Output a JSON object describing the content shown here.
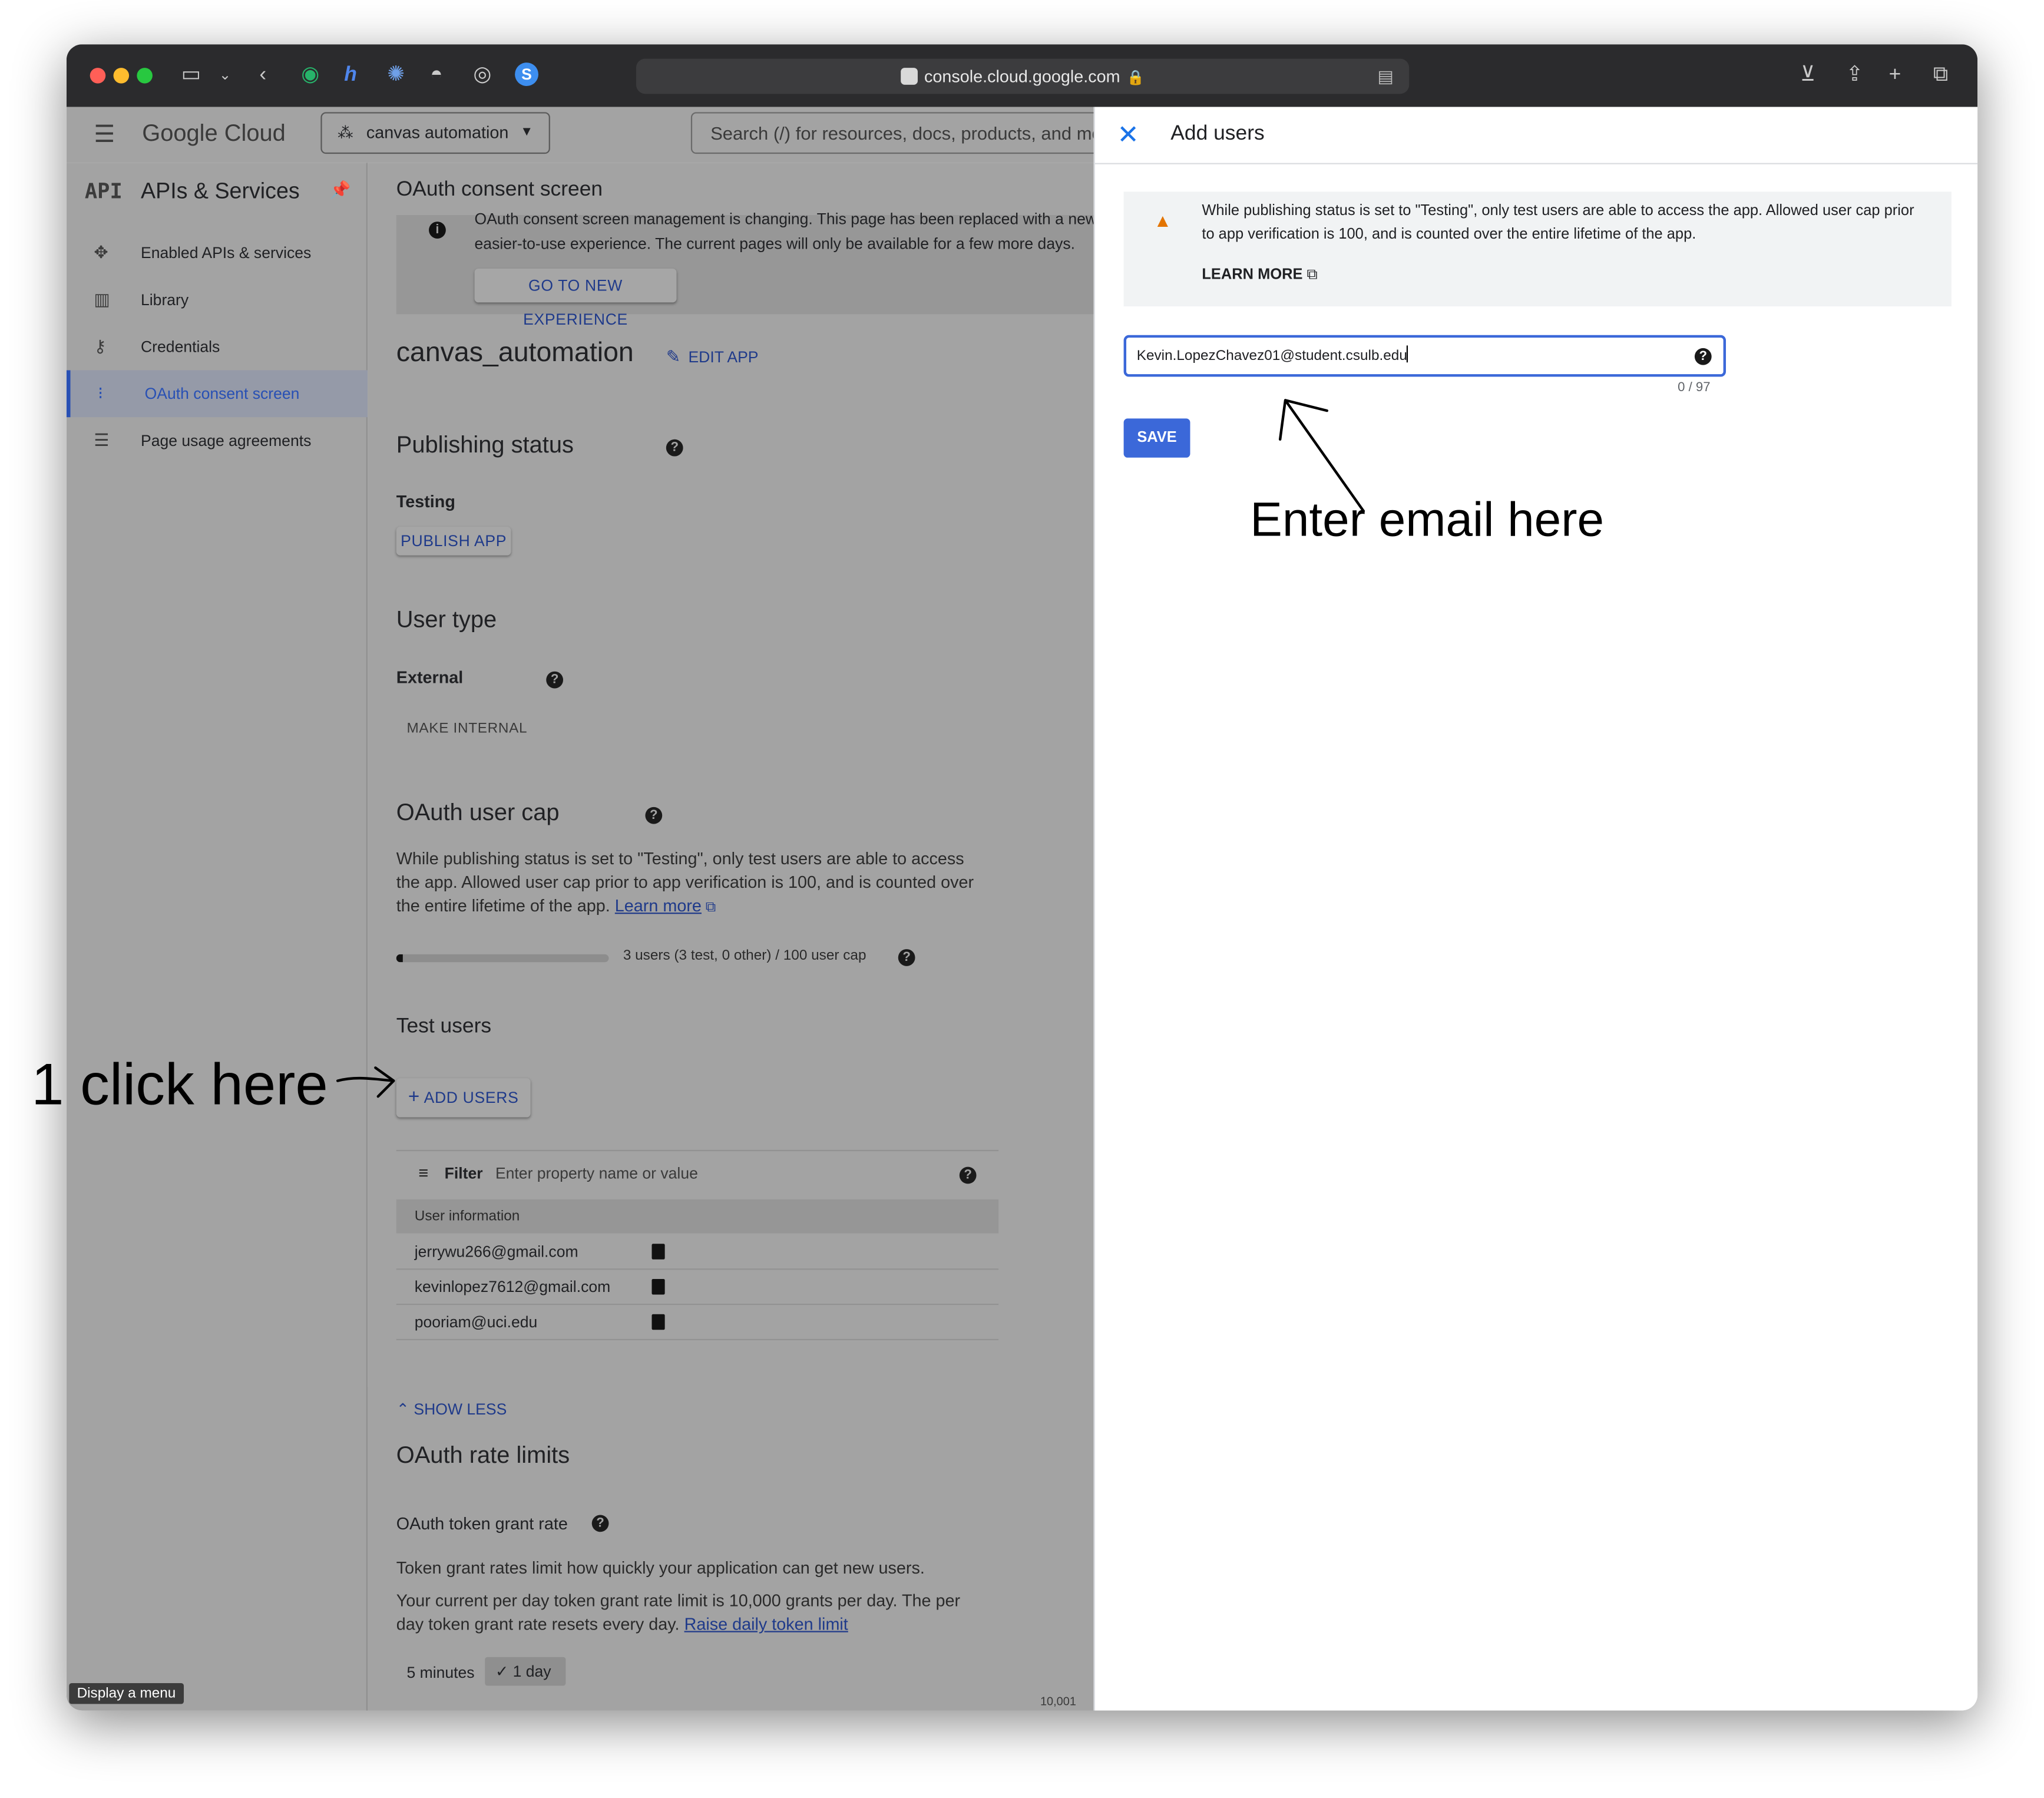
{
  "browser": {
    "url": "console.cloud.google.com",
    "tooltip": "Display a menu"
  },
  "header": {
    "logo": "Google Cloud",
    "project": "canvas automation",
    "search_placeholder": "Search (/) for resources, docs, products, and mor"
  },
  "sidebar": {
    "title": "APIs & Services",
    "api_badge": "API",
    "items": [
      {
        "label": "Enabled APIs & services",
        "icon": "apis-icon"
      },
      {
        "label": "Library",
        "icon": "library-icon"
      },
      {
        "label": "Credentials",
        "icon": "key-icon"
      },
      {
        "label": "OAuth consent screen",
        "icon": "consent-icon",
        "active": true
      },
      {
        "label": "Page usage agreements",
        "icon": "settings-list-icon"
      }
    ]
  },
  "main": {
    "page_title": "OAuth consent screen",
    "notice_line1": "OAuth consent screen management is changing. This page has been replaced with a new,",
    "notice_line2": "easier-to-use experience. The current pages will only be available for a few more days.",
    "go_new": "GO TO NEW EXPERIENCE",
    "app_name": "canvas_automation",
    "edit_app": "EDIT APP",
    "publishing_status_heading": "Publishing status",
    "publishing_status_value": "Testing",
    "publish_app": "PUBLISH APP",
    "user_type_heading": "User type",
    "user_type_value": "External",
    "make_internal": "MAKE INTERNAL",
    "user_cap_heading": "OAuth user cap",
    "user_cap_line1": "While publishing status is set to \"Testing\", only test users are able to access",
    "user_cap_line2": "the app. Allowed user cap prior to app verification is 100, and is counted over",
    "user_cap_line3": "the entire lifetime of the app.",
    "learn_more": "Learn more",
    "user_cap_progress": 0.03,
    "user_cap_text": "3 users (3 test, 0 other) / 100 user cap",
    "test_users_heading": "Test users",
    "add_users": "ADD USERS",
    "filter_label": "Filter",
    "filter_placeholder": "Enter property name or value",
    "table_header": "User information",
    "users": [
      "jerrywu266@gmail.com",
      "kevinlopez7612@gmail.com",
      "pooriam@uci.edu"
    ],
    "show_less": "SHOW LESS",
    "rate_limits_heading": "OAuth rate limits",
    "token_grant_heading": "OAuth token grant rate",
    "token_line1": "Token grant rates limit how quickly your application can get new users.",
    "token_line2": "Your current per day token grant rate limit is 10,000 grants per day. The per",
    "token_line3": "day token grant rate resets every day.",
    "raise_limit": "Raise daily token limit",
    "range_5min": "5 minutes",
    "range_1day": "1 day",
    "axis_value": "10,001"
  },
  "panel": {
    "title": "Add users",
    "warning_line1": "While publishing status is set to \"Testing\", only test users are able to access the app. Allowed user cap prior",
    "warning_line2": "to app verification is 100, and is counted over the entire lifetime of the app.",
    "learn_more": "LEARN MORE",
    "email_value": "Kevin.LopezChavez01@student.csulb.edu",
    "char_count": "0 / 97",
    "save": "SAVE"
  },
  "annotations": {
    "enter_email": "Enter email here",
    "click_here": "1 click here"
  },
  "colors": {
    "accent": "#1a73e8",
    "save_button": "#3b68d9",
    "warning": "#e37400",
    "active_nav": "#2850b4"
  }
}
